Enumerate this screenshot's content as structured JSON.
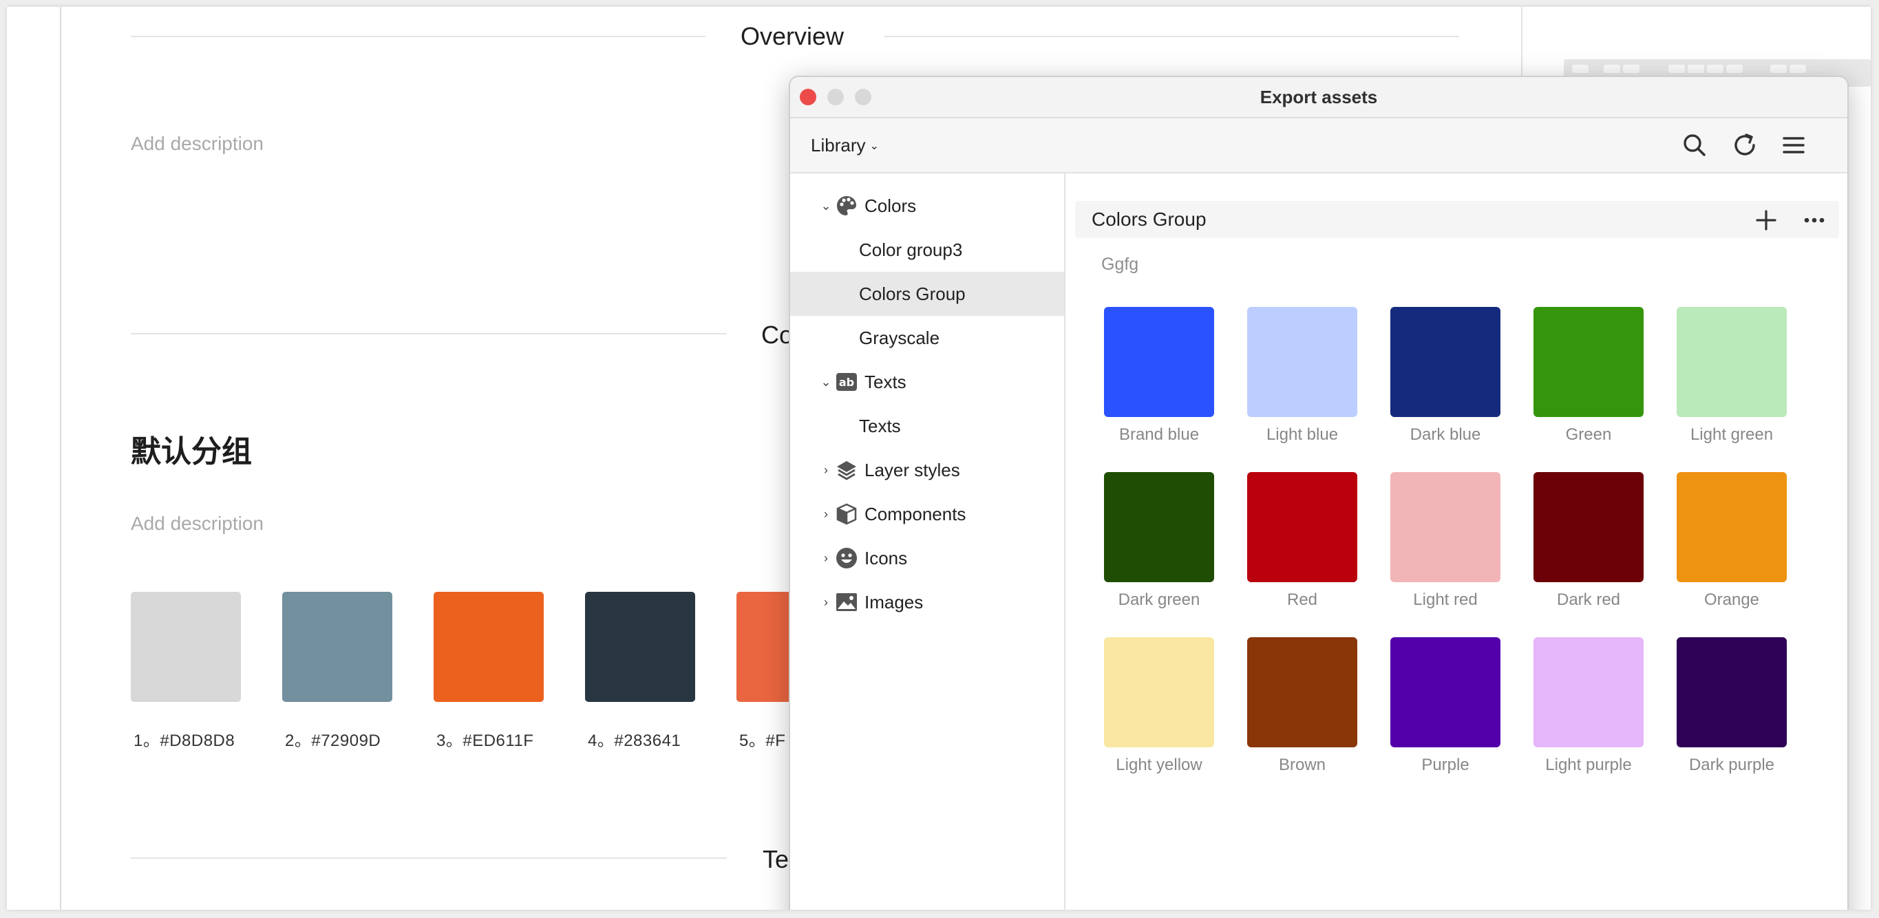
{
  "document": {
    "overview_heading": "Overview",
    "description_placeholder": "Add description",
    "section_colors_partial": "Co",
    "section_texts_partial": "Te",
    "group_title": "默认分组",
    "swatches": [
      {
        "label": "1。#D8D8D8",
        "color": "#D8D8D8"
      },
      {
        "label": "2。#72909D",
        "color": "#72909D"
      },
      {
        "label": "3。#ED611F",
        "color": "#ED611F"
      },
      {
        "label": "4。#283641",
        "color": "#283641"
      },
      {
        "label": "5。#F",
        "color": "#EA6640"
      }
    ]
  },
  "window": {
    "title": "Export assets",
    "traffic_lights": {
      "close": "#ED4A4A",
      "minimize": "#D8D8D8",
      "zoom": "#D8D8D8"
    },
    "toolbar": {
      "library_label": "Library",
      "icons": [
        "search-icon",
        "refresh-icon",
        "menu-icon"
      ]
    },
    "sidebar": {
      "colors": {
        "label": "Colors",
        "icon": "palette-icon",
        "children": [
          "Color group3",
          "Colors Group",
          "Grayscale"
        ],
        "selected": "Colors Group"
      },
      "texts": {
        "label": "Texts",
        "icon": "text-ab-icon",
        "children": [
          "Texts"
        ]
      },
      "layer_styles": {
        "label": "Layer styles",
        "icon": "layers-icon"
      },
      "components": {
        "label": "Components",
        "icon": "cube-icon"
      },
      "icons": {
        "label": "Icons",
        "icon": "smiley-icon"
      },
      "images": {
        "label": "Images",
        "icon": "image-icon"
      }
    },
    "main": {
      "group_title": "Colors Group",
      "group_description": "Ggfg",
      "colors": [
        {
          "name": "Brand blue",
          "hex": "#2B52FF"
        },
        {
          "name": "Light blue",
          "hex": "#BCCDFF"
        },
        {
          "name": "Dark blue",
          "hex": "#162A7D"
        },
        {
          "name": "Green",
          "hex": "#35960B"
        },
        {
          "name": "Light green",
          "hex": "#BAEABA"
        },
        {
          "name": "Dark green",
          "hex": "#1E4D03"
        },
        {
          "name": "Red",
          "hex": "#B9000C"
        },
        {
          "name": "Light red",
          "hex": "#F2B5B7"
        },
        {
          "name": "Dark red",
          "hex": "#6B0006"
        },
        {
          "name": "Orange",
          "hex": "#EE9211"
        },
        {
          "name": "Light yellow",
          "hex": "#FAE8A2"
        },
        {
          "name": "Brown",
          "hex": "#8A3609"
        },
        {
          "name": "Purple",
          "hex": "#5300AB"
        },
        {
          "name": "Light purple",
          "hex": "#E6B6FA"
        },
        {
          "name": "Dark purple",
          "hex": "#2E0056"
        }
      ]
    }
  }
}
